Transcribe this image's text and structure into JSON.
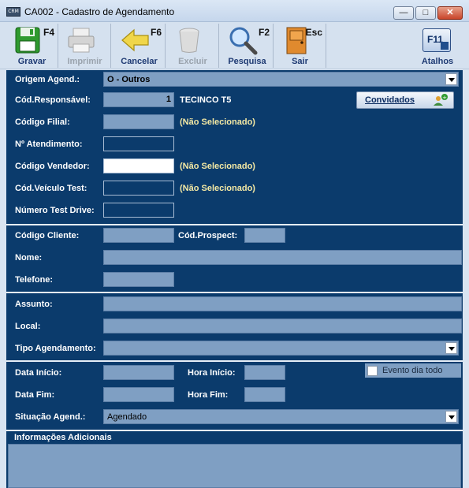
{
  "window": {
    "title": "CA002 - Cadastro de Agendamento",
    "app_icon_text": "CRM",
    "min_glyph": "—",
    "max_glyph": "□",
    "close_glyph": "✕"
  },
  "toolbar": {
    "buttons": [
      {
        "label": "Gravar",
        "key": "F4",
        "icon": "floppy-disk-icon",
        "enabled": true
      },
      {
        "label": "Imprimir",
        "key": "",
        "icon": "printer-icon",
        "enabled": false
      },
      {
        "label": "Cancelar",
        "key": "F6",
        "icon": "back-arrow-icon",
        "enabled": true
      },
      {
        "label": "Excluir",
        "key": "",
        "icon": "trash-icon",
        "enabled": false
      },
      {
        "label": "Pesquisa",
        "key": "F2",
        "icon": "magnifier-icon",
        "enabled": true
      },
      {
        "label": "Sair",
        "key": "Esc",
        "icon": "door-icon",
        "enabled": true
      }
    ],
    "atalhos": {
      "label": "Atalhos",
      "key": "F11"
    }
  },
  "form": {
    "origem": {
      "label": "Origem Agend.:",
      "value": "O - Outros"
    },
    "responsavel": {
      "label": "Cód.Responsável:",
      "code": "1",
      "name": "TECINCO T5"
    },
    "convidados_label": "Convidados",
    "filial": {
      "label": "Código Filial:",
      "note": "(Não Selecionado)"
    },
    "atendimento": {
      "label": "Nº Atendimento:"
    },
    "vendedor": {
      "label": "Código Vendedor:",
      "note": "(Não Selecionado)"
    },
    "veiculo": {
      "label": "Cód.Veículo Test:",
      "note": "(Não Selecionado)"
    },
    "test_drive": {
      "label": "Número Test Drive:"
    },
    "cliente": {
      "label": "Código Cliente:"
    },
    "prospect": {
      "label": "Cód.Prospect:"
    },
    "nome": {
      "label": "Nome:"
    },
    "telefone": {
      "label": "Telefone:"
    },
    "assunto": {
      "label": "Assunto:"
    },
    "local": {
      "label": "Local:"
    },
    "tipo": {
      "label": "Tipo Agendamento:",
      "value": ""
    },
    "data_inicio": {
      "label": "Data Início:"
    },
    "hora_inicio": {
      "label": "Hora Início:"
    },
    "evento_dia_todo": {
      "label": "Evento dia todo",
      "checked": false
    },
    "data_fim": {
      "label": "Data Fim:"
    },
    "hora_fim": {
      "label": "Hora Fim:"
    },
    "situacao": {
      "label": "Situação Agend.:",
      "value": "Agendado"
    },
    "info_adicionais": {
      "label": "Informações Adicionais"
    }
  }
}
